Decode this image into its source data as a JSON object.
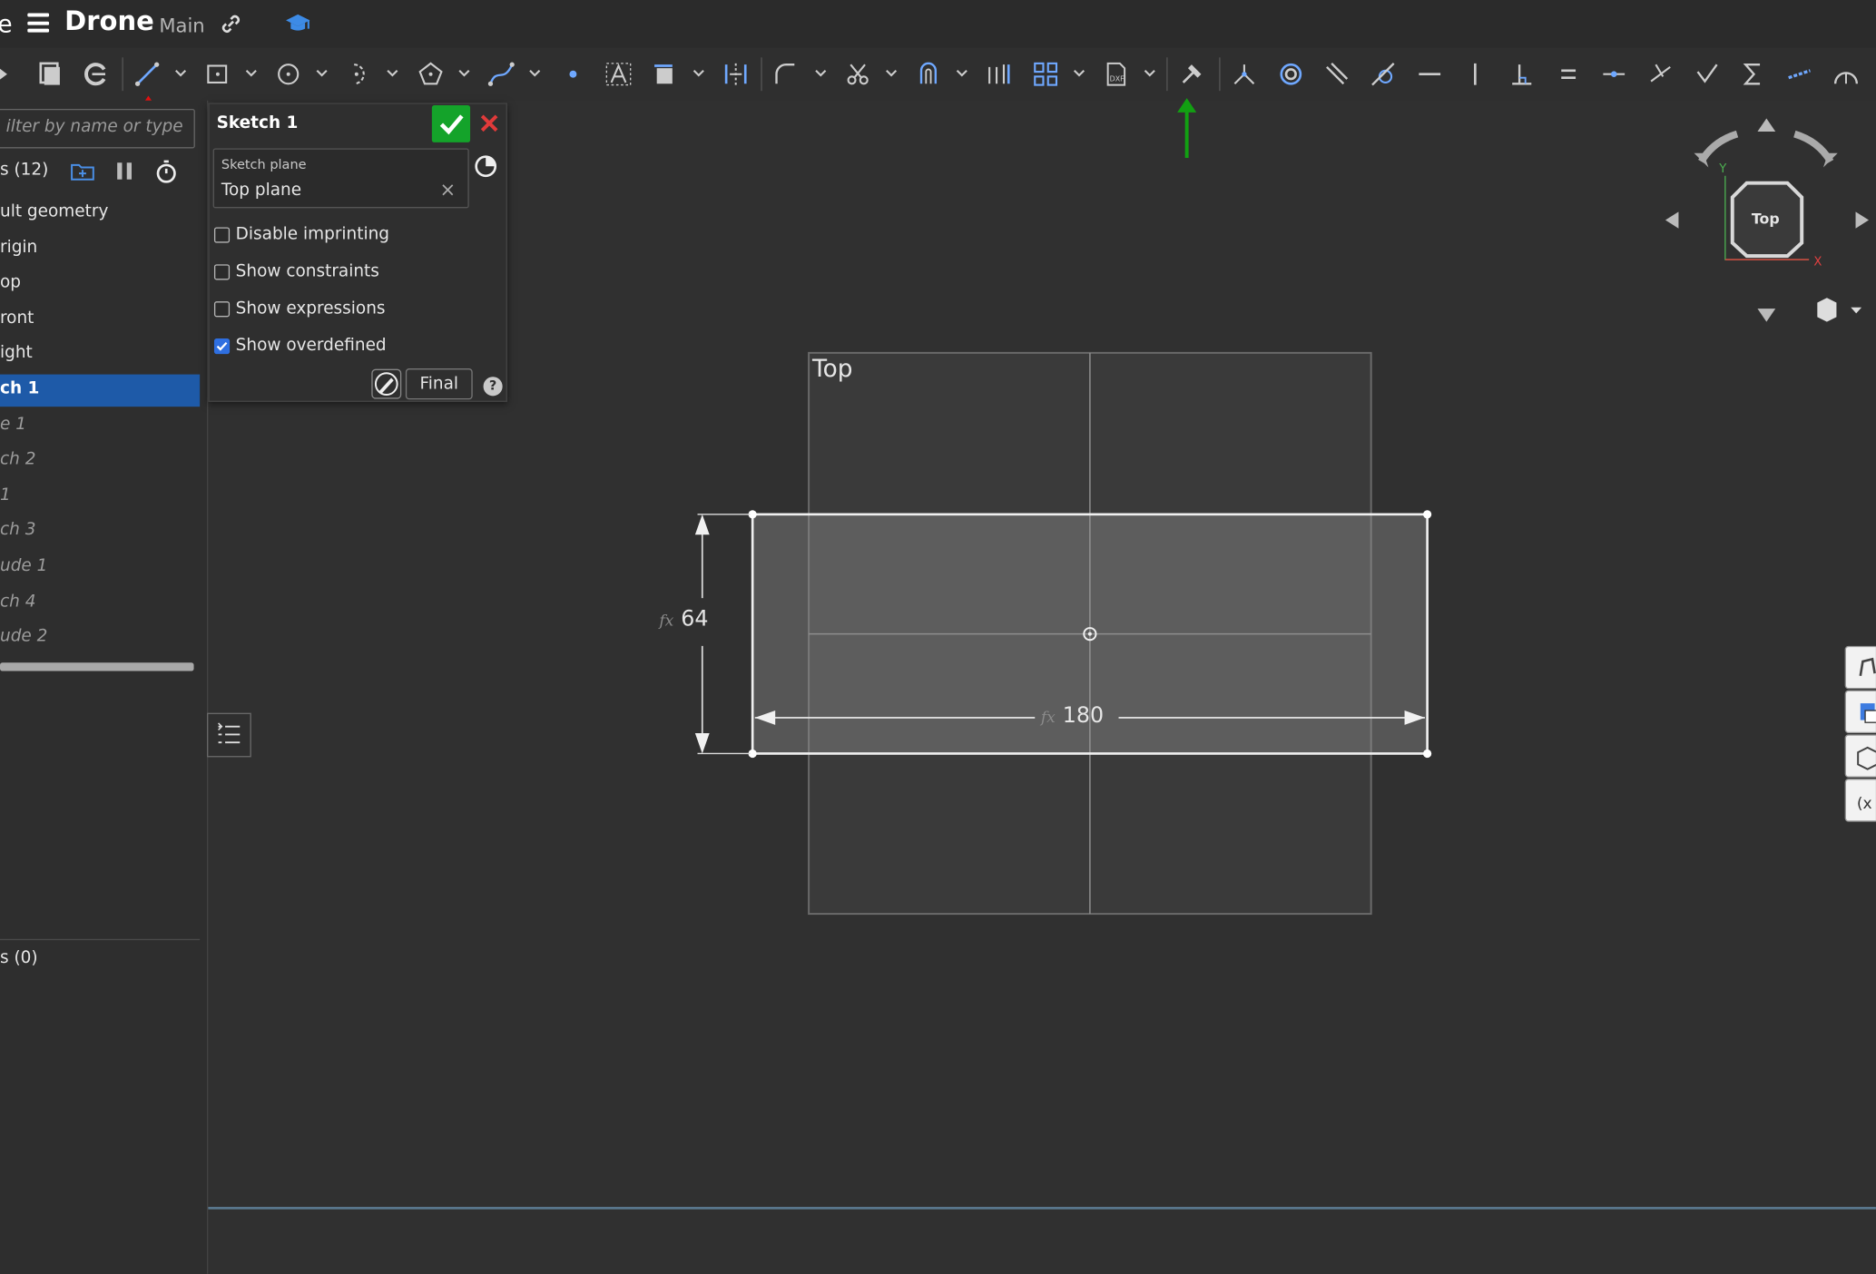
{
  "titlebar": {
    "cut_text": "e",
    "doc_name": "Drone",
    "branch": "Main"
  },
  "feature_list": {
    "filter_placeholder": "ilter by name or type",
    "header_label": "s (12)",
    "items": [
      {
        "label": "ult geometry",
        "state": "normal"
      },
      {
        "label": "rigin",
        "state": "normal"
      },
      {
        "label": "op",
        "state": "normal"
      },
      {
        "label": "ront",
        "state": "normal"
      },
      {
        "label": "ight",
        "state": "normal"
      },
      {
        "label": "ch 1",
        "state": "selected"
      },
      {
        "label": "e 1",
        "state": "suppressed"
      },
      {
        "label": "ch 2",
        "state": "suppressed"
      },
      {
        "label": "1",
        "state": "suppressed"
      },
      {
        "label": "ch 3",
        "state": "suppressed"
      },
      {
        "label": "ude 1",
        "state": "suppressed"
      },
      {
        "label": "ch 4",
        "state": "suppressed"
      },
      {
        "label": "ude 2",
        "state": "suppressed"
      }
    ],
    "parts_label": "s (0)"
  },
  "sketch_dialog": {
    "title": "Sketch 1",
    "plane_label": "Sketch plane",
    "plane_value": "Top plane",
    "clear_symbol": "×",
    "options": [
      {
        "label": "Disable imprinting",
        "checked": false
      },
      {
        "label": "Show constraints",
        "checked": false
      },
      {
        "label": "Show expressions",
        "checked": false
      },
      {
        "label": "Show overdefined",
        "checked": true
      }
    ],
    "final_label": "Final",
    "help_symbol": "?"
  },
  "viewport": {
    "plane_name": "Top",
    "dimension_vertical": "64",
    "dimension_horizontal": "180",
    "fx_symbol": "fx"
  },
  "viewcube": {
    "face_label": "Top",
    "axis_y": "Y",
    "axis_x": "X"
  },
  "annotations": {
    "red_arrow_color": "#e01010",
    "green_arrow_color": "#12a012"
  },
  "colors": {
    "accent_blue": "#1e5aa8",
    "ok_green": "#14a32a",
    "cancel_red": "#e03a3a"
  }
}
